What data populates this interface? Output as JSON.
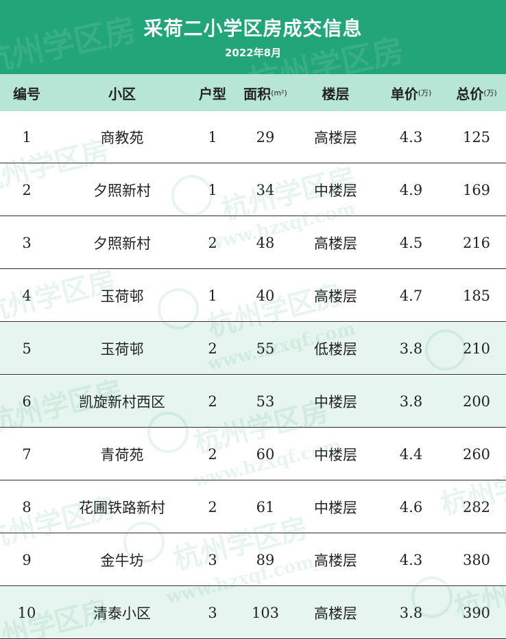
{
  "header": {
    "title": "采荷二小学区房成交信息",
    "subtitle": "2022年8月"
  },
  "columns": [
    {
      "label": "编号",
      "unit": ""
    },
    {
      "label": "小区",
      "unit": ""
    },
    {
      "label": "户型",
      "unit": ""
    },
    {
      "label": "面积",
      "unit": "(m²)"
    },
    {
      "label": "楼层",
      "unit": ""
    },
    {
      "label": "单价",
      "unit": "(万)"
    },
    {
      "label": "总价",
      "unit": "(万)"
    }
  ],
  "rows": [
    {
      "no": "1",
      "community": "商教苑",
      "layout": "1",
      "area": "29",
      "floor": "高楼层",
      "unit_price": "4.3",
      "total_price": "125"
    },
    {
      "no": "2",
      "community": "夕照新村",
      "layout": "1",
      "area": "34",
      "floor": "中楼层",
      "unit_price": "4.9",
      "total_price": "169"
    },
    {
      "no": "3",
      "community": "夕照新村",
      "layout": "2",
      "area": "48",
      "floor": "高楼层",
      "unit_price": "4.5",
      "total_price": "216"
    },
    {
      "no": "4",
      "community": "玉荷邨",
      "layout": "1",
      "area": "40",
      "floor": "高楼层",
      "unit_price": "4.7",
      "total_price": "185"
    },
    {
      "no": "5",
      "community": "玉荷邨",
      "layout": "2",
      "area": "55",
      "floor": "低楼层",
      "unit_price": "3.8",
      "total_price": "210"
    },
    {
      "no": "6",
      "community": "凯旋新村西区",
      "layout": "2",
      "area": "53",
      "floor": "中楼层",
      "unit_price": "3.8",
      "total_price": "200"
    },
    {
      "no": "7",
      "community": "青荷苑",
      "layout": "2",
      "area": "60",
      "floor": "中楼层",
      "unit_price": "4.4",
      "total_price": "260"
    },
    {
      "no": "8",
      "community": "花圃铁路新村",
      "layout": "2",
      "area": "61",
      "floor": "中楼层",
      "unit_price": "4.6",
      "total_price": "282"
    },
    {
      "no": "9",
      "community": "金牛坊",
      "layout": "3",
      "area": "89",
      "floor": "高楼层",
      "unit_price": "4.3",
      "total_price": "380"
    },
    {
      "no": "10",
      "community": "清泰小区",
      "layout": "3",
      "area": "103",
      "floor": "高楼层",
      "unit_price": "3.8",
      "total_price": "390"
    }
  ],
  "watermark": {
    "brand": "杭州学区房",
    "url": "www.hzxqf.com"
  },
  "colors": {
    "banner": "#22a579",
    "header_row": "#b8e6d6",
    "tinted_row": "#e6f5ef"
  }
}
